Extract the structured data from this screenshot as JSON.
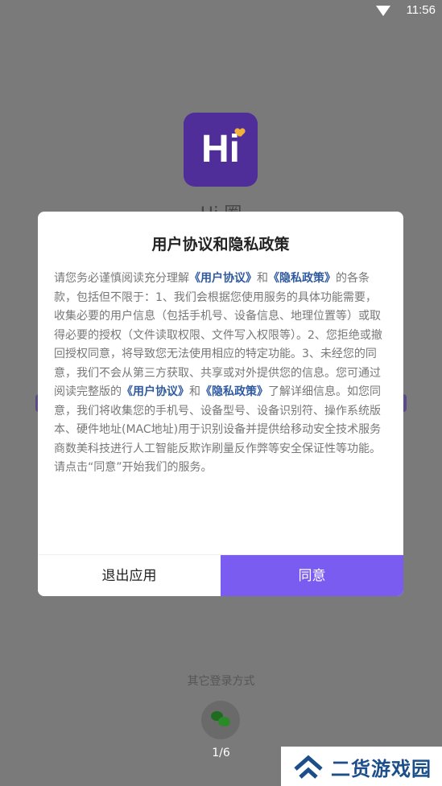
{
  "status_bar": {
    "time": "11:56"
  },
  "app": {
    "icon_text": "Hi",
    "name": "Hi 圈"
  },
  "login": {
    "other_label": "其它登录方式"
  },
  "pager": {
    "text": "1/6"
  },
  "watermark": {
    "text": "二货游戏园"
  },
  "dialog": {
    "title": "用户协议和隐私政策",
    "body": [
      {
        "t": "请您务必谨慎阅读充分理解"
      },
      {
        "t": "《用户协议》",
        "link": true
      },
      {
        "t": "和"
      },
      {
        "t": "《隐私政策》",
        "link": true
      },
      {
        "t": "的各条款，包括但不限于：1、我们会根据您使用服务的具体功能需要，收集必要的用户信息（包括手机号、设备信息、地理位置等）或取得必要的授权（文件读取权限、文件写入权限等）。2、您拒绝或撤回授权同意，将导致您无法使用相应的特定功能。3、未经您的同意，我们不会从第三方获取、共享或对外提供您的信息。您可通过阅读完整版的"
      },
      {
        "t": "《用户协议》",
        "link": true
      },
      {
        "t": "和"
      },
      {
        "t": "《隐私政策》",
        "link": true
      },
      {
        "t": "了解详细信息。如您同意，我们将收集您的手机号、设备型号、设备识别符、操作系统版本、硬件地址(MAC地址)用于识别设备并提供给移动安全技术服务商数美科技进行人工智能反欺诈刷量反作弊等安全保证性等功能。请点击“同意”开始我们的服务。"
      }
    ],
    "exit_label": "退出应用",
    "agree_label": "同意"
  },
  "colors": {
    "accent": "#7b5cf0",
    "link": "#2f5a9e",
    "app_icon": "#4f2e99"
  }
}
